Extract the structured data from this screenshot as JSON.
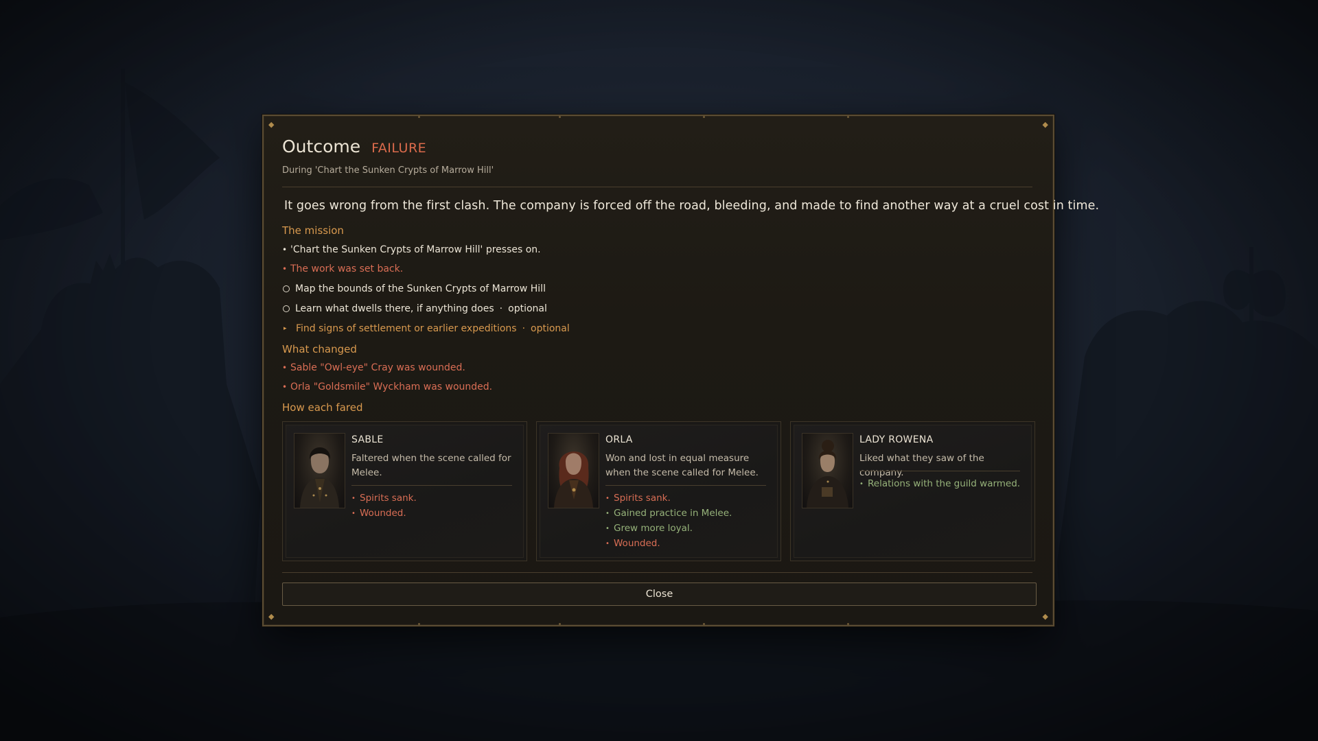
{
  "dialog": {
    "title": "Outcome",
    "status": "FAILURE",
    "subtitle": "During 'Chart the Sunken Crypts of Marrow Hill'",
    "narrative": "It goes wrong from the first clash. The company is forced off the road, bleeding, and made to find another way at a cruel cost in time.",
    "close_label": "Close"
  },
  "mission": {
    "heading": "The mission",
    "presses_on": "'Chart the Sunken Crypts of Marrow Hill' presses on.",
    "setback": "The work was set back.",
    "objectives": [
      {
        "text": "Map the bounds of the Sunken Crypts of Marrow Hill",
        "optional_label": ""
      },
      {
        "text": "Learn what dwells there, if anything does",
        "optional_label": "optional"
      },
      {
        "text": "Find signs of settlement or earlier expeditions",
        "optional_label": "optional"
      }
    ]
  },
  "changes": {
    "heading": "What changed",
    "items": [
      "Sable \"Owl-eye\" Cray was wounded.",
      "Orla \"Goldsmile\" Wyckham was wounded."
    ]
  },
  "fared": {
    "heading": "How each fared",
    "characters": [
      {
        "name": "SABLE",
        "description": "Faltered when the scene called for Melee.",
        "effects": [
          "Spirits sank.",
          "Wounded."
        ]
      },
      {
        "name": "ORLA",
        "description": "Won and lost in equal measure when the scene called for Melee.",
        "effects": [
          "Spirits sank.",
          "Gained practice in Melee.",
          "Grew more loyal.",
          "Wounded."
        ]
      },
      {
        "name": "LADY ROWENA",
        "description": "Liked what they saw of the company.",
        "effects": [
          "Relations with the guild warmed."
        ]
      }
    ]
  },
  "colors": {
    "failure": "#dc6b4c",
    "accent": "#d99a4f",
    "negative": "#da6e55",
    "positive": "#96b27a"
  },
  "icons": {
    "corner": "ornate-corner-icon",
    "objective_open": "hollow-circle-icon",
    "objective_active": "triangle-marker-icon"
  }
}
